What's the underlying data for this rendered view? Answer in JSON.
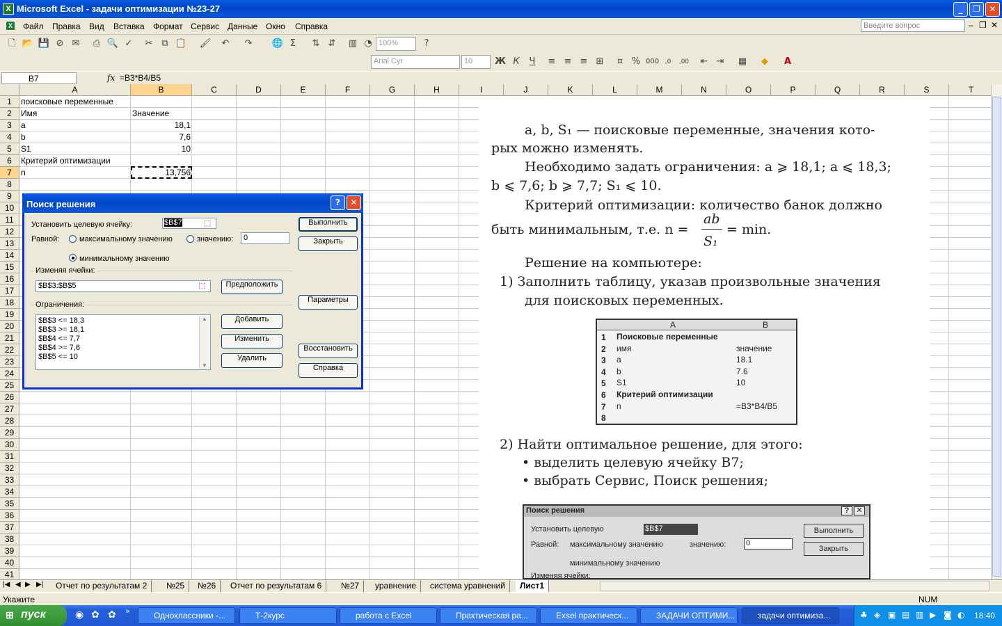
{
  "window": {
    "title": "Microsoft Excel - задачи оптимизации №23-27"
  },
  "menu": [
    "Файл",
    "Правка",
    "Вид",
    "Вставка",
    "Формат",
    "Сервис",
    "Данные",
    "Окно",
    "Справка"
  ],
  "ask_placeholder": "Введите вопрос",
  "toolbar": {
    "zoom": "100%",
    "font": "Arial Cyr",
    "size": "10"
  },
  "formula_bar": {
    "name_box": "B7",
    "fx": "fx",
    "formula": "=B3*B4/B5"
  },
  "columns": [
    "A",
    "B",
    "C",
    "D",
    "E",
    "F",
    "G",
    "H",
    "I",
    "J",
    "K",
    "L",
    "M",
    "N",
    "O",
    "P",
    "Q",
    "R",
    "S",
    "T"
  ],
  "rows": [
    "1",
    "2",
    "3",
    "4",
    "5",
    "6",
    "7",
    "8",
    "9",
    "10",
    "11",
    "12",
    "13",
    "14",
    "15",
    "16",
    "17",
    "18",
    "19",
    "20",
    "21",
    "22",
    "23",
    "24",
    "25",
    "26",
    "27",
    "28",
    "29",
    "30",
    "31",
    "32",
    "33",
    "34",
    "35",
    "36",
    "37",
    "38",
    "39",
    "40",
    "41"
  ],
  "cells": {
    "a1": "поисковые переменные",
    "a2": "Имя",
    "b2": "Значение",
    "a3": "a",
    "b3": "18,1",
    "a4": "b",
    "b4": "7,6",
    "a5": "S1",
    "b5": "10",
    "a6": "Критерий оптимизации",
    "a7": "n",
    "b7": "13,756"
  },
  "solver": {
    "title": "Поиск решения",
    "target_label": "Установить целевую ячейку:",
    "target_value": "$B$7",
    "equal_label": "Равной:",
    "opt_max": "максимальному значению",
    "opt_value": "значению:",
    "value_field": "0",
    "opt_min": "минимальному значению",
    "changing_label": "Изменяя ячейки:",
    "changing_value": "$B$3:$B$5",
    "guess": "Предположить",
    "constraints_label": "Ограничения:",
    "constraints": [
      "$B$3 <= 18,3",
      "$B$3 >= 18,1",
      "$B$4 <= 7,7",
      "$B$4 >= 7,6",
      "$B$5 <= 10"
    ],
    "add": "Добавить",
    "change": "Изменить",
    "delete": "Удалить",
    "solve": "Выполнить",
    "close": "Закрыть",
    "options": "Параметры",
    "reset": "Восстановить",
    "help": "Справка"
  },
  "doc": {
    "l1": "a, b, S₁ — поисковые переменные, значения кото-",
    "l2": "рых можно изменять.",
    "l3": "Необходимо задать ограничения: a ⩾ 18,1; a ⩽ 18,3;",
    "l4": "b ⩽ 7,6; b ⩾ 7,7; S₁ ⩽ 10.",
    "l5": "Критерий оптимизации: количество банок должно",
    "l6a": "быть минимальным, т.е. n =",
    "l6num": "ab",
    "l6den": "S₁",
    "l6b": "= min.",
    "l7": "Решение на компьютере:",
    "l8": "1)  Заполнить таблицу, указав произвольные значения",
    "l9": "для поисковых переменных.",
    "table": {
      "ha": "A",
      "hb": "B",
      "r1": "Поисковые переменные",
      "r2a": "имя",
      "r2b": "значение",
      "r3a": "a",
      "r3b": "18.1",
      "r4a": "b",
      "r4b": "7.6",
      "r5a": "S1",
      "r5b": "10",
      "r6": "Критерий оптимизации",
      "r7a": "n",
      "r7b": "=B3*B4/B5"
    },
    "l10": "2)  Найти оптимальное решение, для этого:",
    "l11": "•  выделить целевую ячейку B7;",
    "l12": "•  выбрать Сервис, Поиск решения;",
    "dlg": {
      "title": "Поиск решения",
      "target": "Установить целевую",
      "target_val": "$B$7",
      "solve": "Выполнить",
      "equal": "Равной:",
      "max": "максимальному значению",
      "val": "значению:",
      "val_field": "0",
      "close": "Закрыть",
      "min": "минимальному значению",
      "changing": "Изменяя ячейки:"
    }
  },
  "sheet_tabs": [
    "Отчет по результатам 2",
    "№25",
    "№26",
    "Отчет по результатам 6",
    "№27",
    "уравнение",
    "система уравнений",
    "Лист1"
  ],
  "status": {
    "left": "Укажите",
    "num": "NUM"
  },
  "taskbar": {
    "start": "пуск",
    "items": [
      "Одноклассники -...",
      "Т-2курс",
      "работа с Excel",
      "Практическая ра...",
      "Exsel практическ...",
      "ЗАДАЧИ ОПТИМИ...",
      "задачи оптимиза..."
    ],
    "clock": "18:40"
  }
}
